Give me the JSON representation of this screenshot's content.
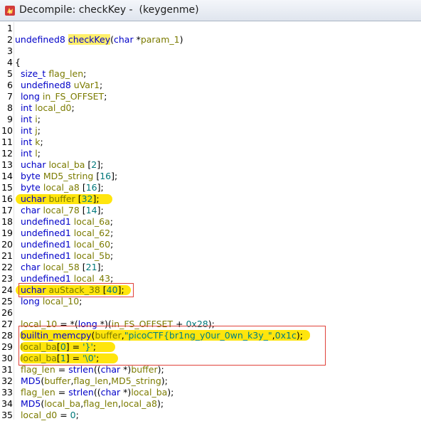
{
  "window": {
    "title": "Decompile: checkKey -  (keygenme)",
    "icon": "ghidra-dragon-icon"
  },
  "lines": [
    {
      "n": "1",
      "t": []
    },
    {
      "n": "2",
      "t": [
        {
          "c": "undefined8 ",
          "k": "ty"
        },
        {
          "c": "checkKey",
          "k": "hlfn"
        },
        {
          "c": "(",
          "k": "plain"
        },
        {
          "c": "char",
          "k": "ty"
        },
        {
          "c": " *",
          "k": "plain"
        },
        {
          "c": "param_1",
          "k": "var"
        },
        {
          "c": ")",
          "k": "plain"
        }
      ]
    },
    {
      "n": "3",
      "t": []
    },
    {
      "n": "4",
      "t": [
        {
          "c": "{",
          "k": "plain"
        }
      ]
    },
    {
      "n": "5",
      "t": [
        {
          "c": "  size_t ",
          "k": "ty"
        },
        {
          "c": "flag_len",
          "k": "loc"
        },
        {
          "c": ";",
          "k": "plain"
        }
      ]
    },
    {
      "n": "6",
      "t": [
        {
          "c": "  undefined8 ",
          "k": "ty"
        },
        {
          "c": "uVar1",
          "k": "loc"
        },
        {
          "c": ";",
          "k": "plain"
        }
      ]
    },
    {
      "n": "7",
      "t": [
        {
          "c": "  long ",
          "k": "ty"
        },
        {
          "c": "in_FS_OFFSET",
          "k": "loc"
        },
        {
          "c": ";",
          "k": "plain"
        }
      ]
    },
    {
      "n": "8",
      "t": [
        {
          "c": "  int ",
          "k": "ty"
        },
        {
          "c": "local_d0",
          "k": "loc"
        },
        {
          "c": ";",
          "k": "plain"
        }
      ]
    },
    {
      "n": "9",
      "t": [
        {
          "c": "  int ",
          "k": "ty"
        },
        {
          "c": "i",
          "k": "loc"
        },
        {
          "c": ";",
          "k": "plain"
        }
      ]
    },
    {
      "n": "10",
      "t": [
        {
          "c": "  int ",
          "k": "ty"
        },
        {
          "c": "j",
          "k": "loc"
        },
        {
          "c": ";",
          "k": "plain"
        }
      ]
    },
    {
      "n": "11",
      "t": [
        {
          "c": "  int ",
          "k": "ty"
        },
        {
          "c": "k",
          "k": "loc"
        },
        {
          "c": ";",
          "k": "plain"
        }
      ]
    },
    {
      "n": "12",
      "t": [
        {
          "c": "  int ",
          "k": "ty"
        },
        {
          "c": "l",
          "k": "loc"
        },
        {
          "c": ";",
          "k": "plain"
        }
      ]
    },
    {
      "n": "13",
      "t": [
        {
          "c": "  uchar ",
          "k": "ty"
        },
        {
          "c": "local_ba",
          "k": "loc"
        },
        {
          "c": " [",
          "k": "plain"
        },
        {
          "c": "2",
          "k": "num"
        },
        {
          "c": "];",
          "k": "plain"
        }
      ]
    },
    {
      "n": "14",
      "t": [
        {
          "c": "  byte ",
          "k": "ty"
        },
        {
          "c": "MD5_string",
          "k": "loc"
        },
        {
          "c": " [",
          "k": "plain"
        },
        {
          "c": "16",
          "k": "num"
        },
        {
          "c": "];",
          "k": "plain"
        }
      ]
    },
    {
      "n": "15",
      "t": [
        {
          "c": "  byte ",
          "k": "ty"
        },
        {
          "c": "local_a8",
          "k": "loc"
        },
        {
          "c": " [",
          "k": "plain"
        },
        {
          "c": "16",
          "k": "num"
        },
        {
          "c": "];",
          "k": "plain"
        }
      ]
    },
    {
      "n": "16",
      "t": [
        {
          "c": "  uchar ",
          "k": "ty"
        },
        {
          "c": "buffer",
          "k": "loc"
        },
        {
          "c": " [",
          "k": "plain"
        },
        {
          "c": "32",
          "k": "num"
        },
        {
          "c": "];",
          "k": "plain"
        }
      ]
    },
    {
      "n": "17",
      "t": [
        {
          "c": "  char ",
          "k": "ty"
        },
        {
          "c": "local_78",
          "k": "loc"
        },
        {
          "c": " [",
          "k": "plain"
        },
        {
          "c": "14",
          "k": "num"
        },
        {
          "c": "];",
          "k": "plain"
        }
      ]
    },
    {
      "n": "18",
      "t": [
        {
          "c": "  undefined1 ",
          "k": "ty"
        },
        {
          "c": "local_6a",
          "k": "loc"
        },
        {
          "c": ";",
          "k": "plain"
        }
      ]
    },
    {
      "n": "19",
      "t": [
        {
          "c": "  undefined1 ",
          "k": "ty"
        },
        {
          "c": "local_62",
          "k": "loc"
        },
        {
          "c": ";",
          "k": "plain"
        }
      ]
    },
    {
      "n": "20",
      "t": [
        {
          "c": "  undefined1 ",
          "k": "ty"
        },
        {
          "c": "local_60",
          "k": "loc"
        },
        {
          "c": ";",
          "k": "plain"
        }
      ]
    },
    {
      "n": "21",
      "t": [
        {
          "c": "  undefined1 ",
          "k": "ty"
        },
        {
          "c": "local_5b",
          "k": "loc"
        },
        {
          "c": ";",
          "k": "plain"
        }
      ]
    },
    {
      "n": "22",
      "t": [
        {
          "c": "  char ",
          "k": "ty"
        },
        {
          "c": "local_58",
          "k": "loc"
        },
        {
          "c": " [",
          "k": "plain"
        },
        {
          "c": "21",
          "k": "num"
        },
        {
          "c": "];",
          "k": "plain"
        }
      ]
    },
    {
      "n": "23",
      "t": [
        {
          "c": "  undefined1 ",
          "k": "ty"
        },
        {
          "c": "local_43",
          "k": "loc"
        },
        {
          "c": ";",
          "k": "plain"
        }
      ]
    },
    {
      "n": "24",
      "t": [
        {
          "c": "  uchar ",
          "k": "ty"
        },
        {
          "c": "auStack_38",
          "k": "loc"
        },
        {
          "c": " [",
          "k": "plain"
        },
        {
          "c": "40",
          "k": "num"
        },
        {
          "c": "];",
          "k": "plain"
        }
      ]
    },
    {
      "n": "25",
      "t": [
        {
          "c": "  long ",
          "k": "ty"
        },
        {
          "c": "local_10",
          "k": "loc"
        },
        {
          "c": ";",
          "k": "plain"
        }
      ]
    },
    {
      "n": "26",
      "t": []
    },
    {
      "n": "27",
      "t": [
        {
          "c": "  local_10",
          "k": "loc"
        },
        {
          "c": " = *(",
          "k": "plain"
        },
        {
          "c": "long",
          "k": "ty"
        },
        {
          "c": " *)(",
          "k": "plain"
        },
        {
          "c": "in_FS_OFFSET",
          "k": "loc"
        },
        {
          "c": " + ",
          "k": "plain"
        },
        {
          "c": "0x28",
          "k": "num"
        },
        {
          "c": ");",
          "k": "plain"
        }
      ]
    },
    {
      "n": "28",
      "t": [
        {
          "c": "  builtin_memcpy",
          "k": "fn"
        },
        {
          "c": "(",
          "k": "plain"
        },
        {
          "c": "buffer",
          "k": "loc"
        },
        {
          "c": ",",
          "k": "plain"
        },
        {
          "c": "\"picoCTF{br1ng_y0ur_0wn_k3y_\"",
          "k": "str"
        },
        {
          "c": ",",
          "k": "plain"
        },
        {
          "c": "0x1c",
          "k": "num"
        },
        {
          "c": ");",
          "k": "plain"
        }
      ]
    },
    {
      "n": "29",
      "t": [
        {
          "c": "  local_ba",
          "k": "loc"
        },
        {
          "c": "[",
          "k": "plain"
        },
        {
          "c": "0",
          "k": "num"
        },
        {
          "c": "] = ",
          "k": "plain"
        },
        {
          "c": "'}'",
          "k": "str"
        },
        {
          "c": ";",
          "k": "plain"
        }
      ]
    },
    {
      "n": "30",
      "t": [
        {
          "c": "  local_ba",
          "k": "loc"
        },
        {
          "c": "[",
          "k": "plain"
        },
        {
          "c": "1",
          "k": "num"
        },
        {
          "c": "] = ",
          "k": "plain"
        },
        {
          "c": "'\\0'",
          "k": "str"
        },
        {
          "c": ";",
          "k": "plain"
        }
      ]
    },
    {
      "n": "31",
      "t": [
        {
          "c": "  flag_len",
          "k": "loc"
        },
        {
          "c": " = ",
          "k": "plain"
        },
        {
          "c": "strlen",
          "k": "fn"
        },
        {
          "c": "((",
          "k": "plain"
        },
        {
          "c": "char",
          "k": "ty"
        },
        {
          "c": " *)",
          "k": "plain"
        },
        {
          "c": "buffer",
          "k": "loc"
        },
        {
          "c": ");",
          "k": "plain"
        }
      ]
    },
    {
      "n": "32",
      "t": [
        {
          "c": "  MD5",
          "k": "fn"
        },
        {
          "c": "(",
          "k": "plain"
        },
        {
          "c": "buffer",
          "k": "loc"
        },
        {
          "c": ",",
          "k": "plain"
        },
        {
          "c": "flag_len",
          "k": "loc"
        },
        {
          "c": ",",
          "k": "plain"
        },
        {
          "c": "MD5_string",
          "k": "loc"
        },
        {
          "c": ");",
          "k": "plain"
        }
      ]
    },
    {
      "n": "33",
      "t": [
        {
          "c": "  flag_len",
          "k": "loc"
        },
        {
          "c": " = ",
          "k": "plain"
        },
        {
          "c": "strlen",
          "k": "fn"
        },
        {
          "c": "((",
          "k": "plain"
        },
        {
          "c": "char",
          "k": "ty"
        },
        {
          "c": " *)",
          "k": "plain"
        },
        {
          "c": "local_ba",
          "k": "loc"
        },
        {
          "c": ");",
          "k": "plain"
        }
      ]
    },
    {
      "n": "34",
      "t": [
        {
          "c": "  MD5",
          "k": "fn"
        },
        {
          "c": "(",
          "k": "plain"
        },
        {
          "c": "local_ba",
          "k": "loc"
        },
        {
          "c": ",",
          "k": "plain"
        },
        {
          "c": "flag_len",
          "k": "loc"
        },
        {
          "c": ",",
          "k": "plain"
        },
        {
          "c": "local_a8",
          "k": "loc"
        },
        {
          "c": ");",
          "k": "plain"
        }
      ]
    },
    {
      "n": "35",
      "t": [
        {
          "c": "  local_d0",
          "k": "loc"
        },
        {
          "c": " = ",
          "k": "plain"
        },
        {
          "c": "0",
          "k": "num"
        },
        {
          "c": ";",
          "k": "plain"
        }
      ]
    }
  ],
  "annotations": {
    "highlight_color": "#ffe400",
    "box_color": "#e0413a"
  }
}
